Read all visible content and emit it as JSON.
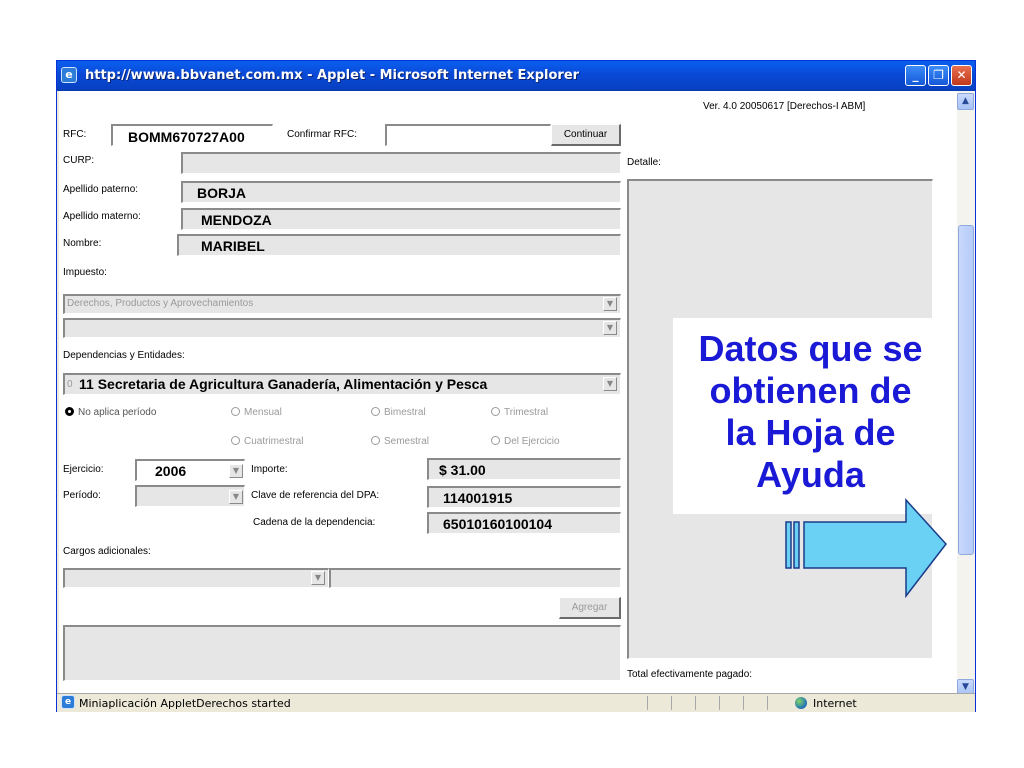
{
  "window": {
    "title": "http://wwwa.bbvanet.com.mx - Applet - Microsoft Internet Explorer",
    "controls": {
      "minimize": "_",
      "maximize": "❐",
      "close": "✕"
    }
  },
  "applet": {
    "version": "Ver. 4.0  20050617  [Derechos-I ABM]",
    "rfc": {
      "label": "RFC:",
      "value": "BOMM670727A00"
    },
    "confirm_rfc": {
      "label": "Confirmar RFC:",
      "value": ""
    },
    "continue_button": "Continuar",
    "curp": {
      "label": "CURP:",
      "value": ""
    },
    "apellido_paterno": {
      "label": "Apellido paterno:",
      "value": "BORJA"
    },
    "apellido_materno": {
      "label": "Apellido materno:",
      "value": "MENDOZA"
    },
    "nombre": {
      "label": "Nombre:",
      "value": "MARIBEL"
    },
    "impuesto": {
      "label": "Impuesto:",
      "selected": "Derechos, Productos y Aprovechamientos",
      "second": ""
    },
    "dependencias": {
      "label": "Dependencias y Entidades:",
      "selected": "11 Secretaria de Agricultura Ganadería, Alimentación y Pesca",
      "prefix": "0"
    },
    "periodos": {
      "options": [
        "No aplica período",
        "Mensual",
        "Bimestral",
        "Trimestral",
        "Cuatrimestral",
        "Semestral",
        "Del Ejercicio"
      ],
      "selected": "No aplica período"
    },
    "ejercicio": {
      "label": "Ejercicio:",
      "value": "2006"
    },
    "periodo": {
      "label": "Período:",
      "value": ""
    },
    "importe": {
      "label": "Importe:",
      "value": "$ 31.00"
    },
    "clave_dpa": {
      "label": "Clave de referencia del DPA:",
      "value": "114001915"
    },
    "cadena": {
      "label": "Cadena de la dependencia:",
      "value": "65010160100104"
    },
    "cargos": {
      "label": "Cargos adicionales:",
      "selected": "",
      "value": ""
    },
    "agregar_button": "Agregar",
    "detalle": {
      "label": "Detalle:"
    },
    "total": {
      "label": "Total efectivamente pagado:"
    }
  },
  "statusbar": {
    "text": "Miniaplicación AppletDerechos started",
    "zone": "Internet"
  },
  "annotation": {
    "lines": [
      "Datos que se",
      "obtienen de",
      "la Hoja de",
      "Ayuda"
    ],
    "color": "#1a1ad6",
    "arrow_fill": "#6ad0f4"
  },
  "icons": [
    "ie-icon",
    "dropdown-arrow-icon",
    "radio-icon",
    "scroll-up-icon",
    "scroll-down-icon",
    "globe-icon"
  ]
}
